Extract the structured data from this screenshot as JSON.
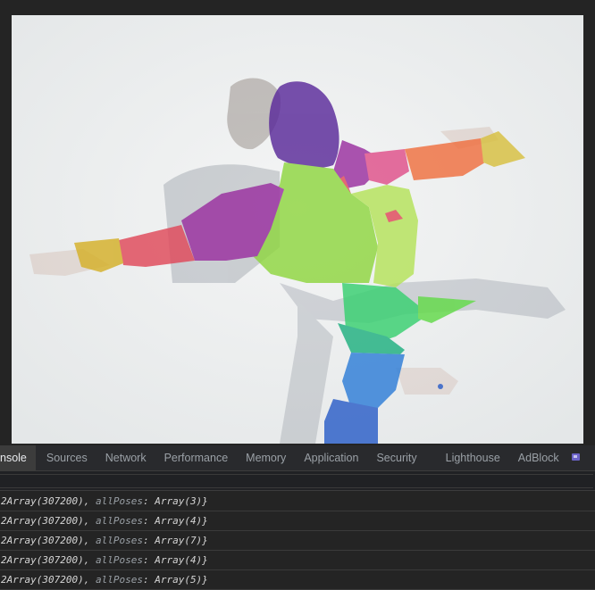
{
  "devtools": {
    "tabs": [
      {
        "label": "nsole",
        "active": true
      },
      {
        "label": "Sources"
      },
      {
        "label": "Network"
      },
      {
        "label": "Performance"
      },
      {
        "label": "Memory"
      },
      {
        "label": "Application"
      },
      {
        "label": "Security"
      },
      {
        "label": "Lighthouse"
      },
      {
        "label": "AdBlock"
      }
    ],
    "more_tabs_icon": "extension-icon"
  },
  "console": {
    "filter_value": "",
    "rows": [
      {
        "prefix": "2Array(307200), ",
        "key": "allPoses",
        "sep": ": ",
        "value": "Array(3)}"
      },
      {
        "prefix": "2Array(307200), ",
        "key": "allPoses",
        "sep": ": ",
        "value": "Array(4)}"
      },
      {
        "prefix": "2Array(307200), ",
        "key": "allPoses",
        "sep": ": ",
        "value": "Array(7)}"
      },
      {
        "prefix": "2Array(307200), ",
        "key": "allPoses",
        "sep": ": ",
        "value": "Array(4)}"
      },
      {
        "prefix": "2Array(307200), ",
        "key": "allPoses",
        "sep": ": ",
        "value": "Array(5)}"
      }
    ]
  },
  "canvas": {
    "subject": "dancer with body-part segmentation overlay",
    "segment_colors": {
      "head": "#5a2a9a",
      "upper_arm": "#9a2fa0",
      "forearm": "#e0495a",
      "hand": "#d4b028",
      "torso_front": "#8fd640",
      "torso_side": "#b5e35a",
      "upper_leg_front": "#38d070",
      "upper_leg_back": "#1fb080",
      "lower_leg_front": "#2f7ed8",
      "lower_leg_back": "#2b5ec8",
      "right_arm_upper": "#e0508a",
      "right_forearm": "#f07040",
      "right_hand": "#d8c040"
    }
  }
}
